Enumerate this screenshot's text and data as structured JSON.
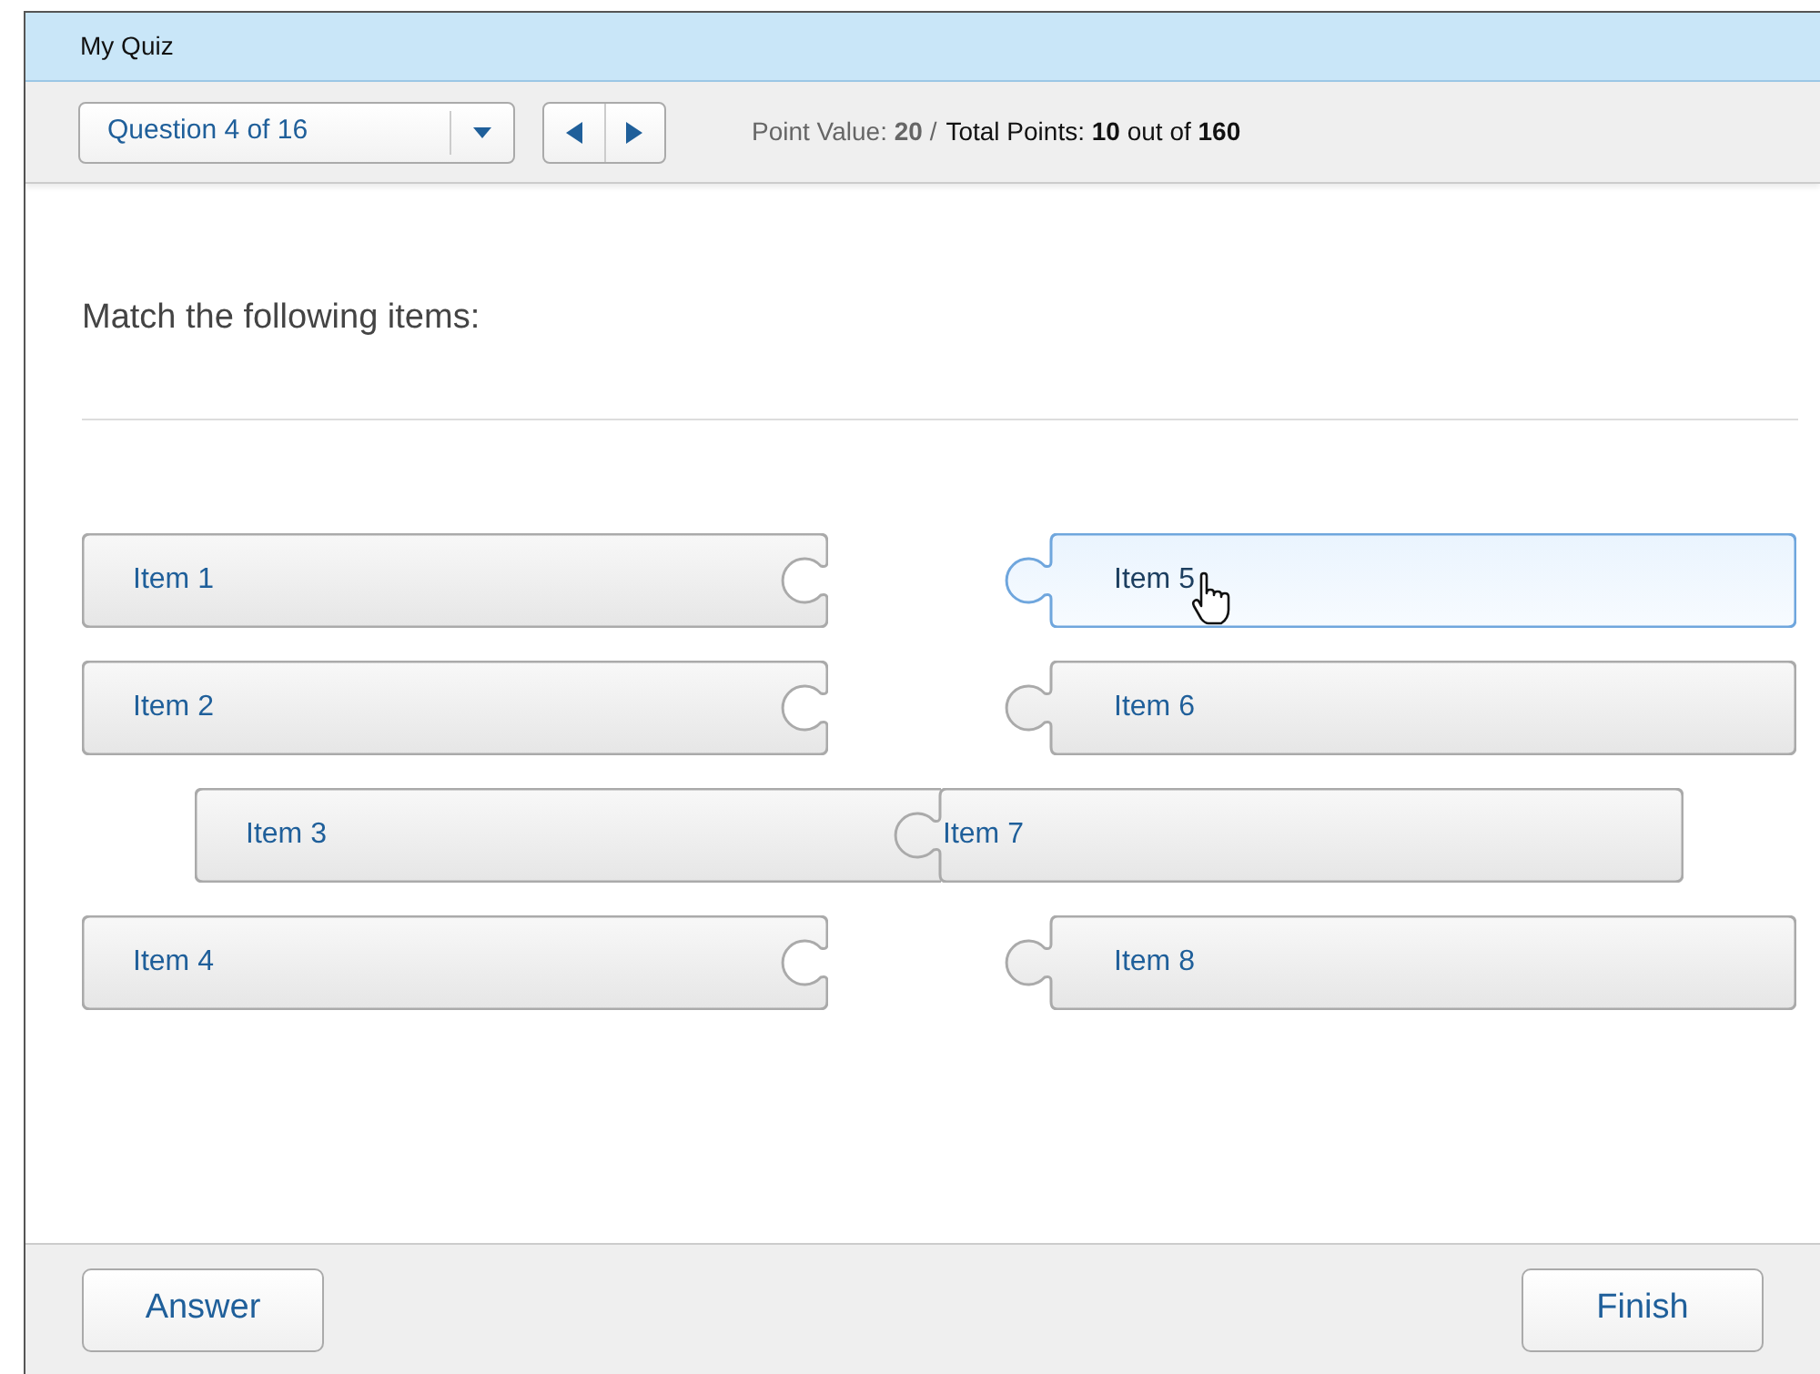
{
  "window": {
    "title": "My Quiz"
  },
  "toolbar": {
    "question_selector": {
      "value": "Question 4 of 16"
    },
    "point_value": "Point Value: **20** /",
    "total_points": "Total Points: **10** out of **160**"
  },
  "question": {
    "prompt": "Match the following items:"
  },
  "pairs": [
    {
      "left": {
        "label": "Item 1"
      },
      "right": {
        "label": "Item 5",
        "highlighted": true
      },
      "matched": false
    },
    {
      "left": {
        "label": "Item 2"
      },
      "right": {
        "label": "Item 6",
        "highlighted": false
      },
      "matched": false
    },
    {
      "left": {
        "label": "Item 3"
      },
      "right": {
        "label": "Item 7",
        "highlighted": false
      },
      "matched": true
    },
    {
      "left": {
        "label": "Item 4"
      },
      "right": {
        "label": "Item 8",
        "highlighted": false
      },
      "matched": false
    }
  ],
  "buttons": [
    {
      "label": "Answer"
    },
    {
      "label": "Finish"
    }
  ]
}
